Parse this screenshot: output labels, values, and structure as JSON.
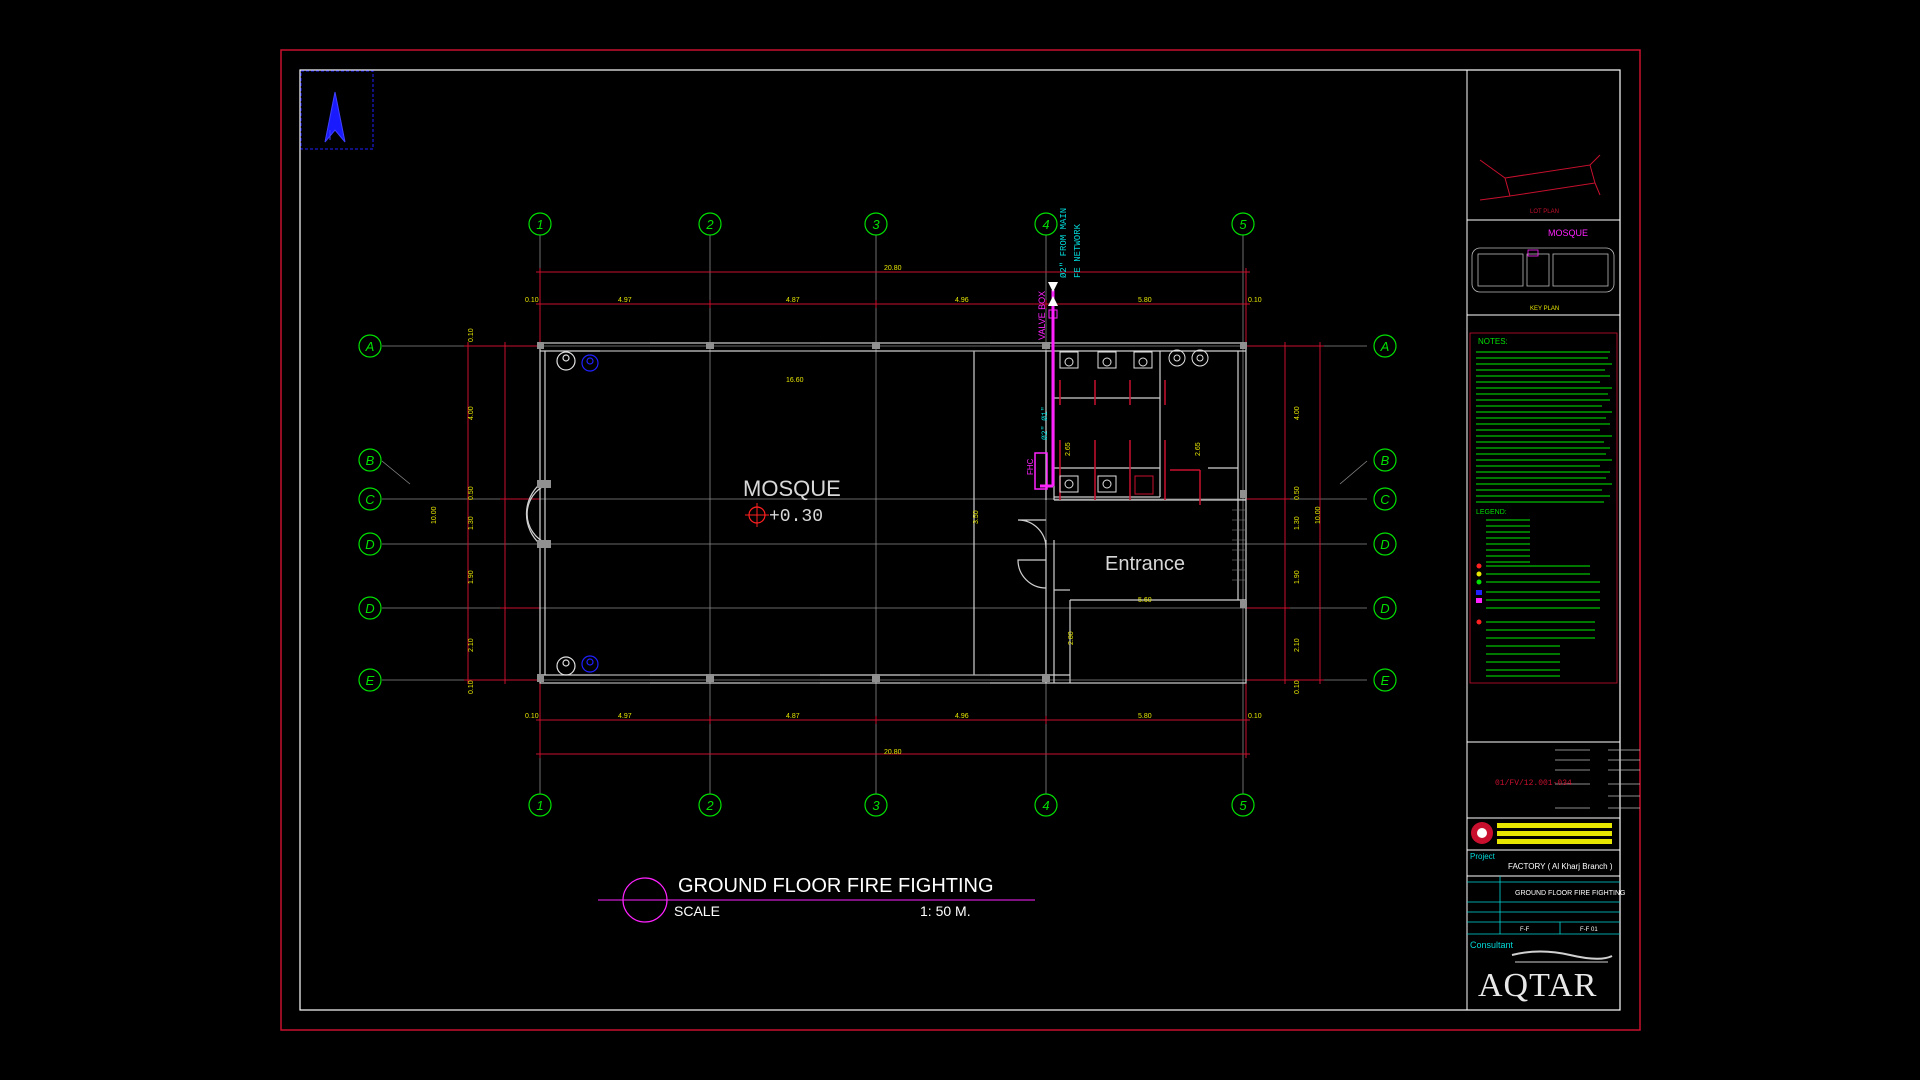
{
  "drawing": {
    "title": "GROUND FLOOR FIRE FIGHTING",
    "scale_label": "SCALE",
    "scale_value": "1: 50 M.",
    "rooms": {
      "mosque": "MOSQUE",
      "entrance": "Entrance"
    },
    "level": "+0.30",
    "pipe_labels": {
      "valve_box": "VALVE BOX",
      "from_main": "Ø2\"  FROM MAIN",
      "fe_network": "FE NETWORK",
      "pipe_size": "Ø2\"  Ø1\"",
      "fhc": "FHC"
    }
  },
  "grid": {
    "columns": [
      "1",
      "2",
      "3",
      "4",
      "5"
    ],
    "rows_left": [
      "A",
      "B",
      "C",
      "D",
      "D",
      "E"
    ],
    "rows_right": [
      "A",
      "B",
      "C",
      "D",
      "D",
      "E"
    ]
  },
  "dimensions": {
    "top_total": "20.80",
    "bottom_total": "20.80",
    "top_spans": [
      "0.10",
      "4.97",
      "4.87",
      "4.96",
      "5.80",
      "0.10"
    ],
    "bottom_spans": [
      "0.10",
      "4.97",
      "4.87",
      "4.96",
      "5.80",
      "0.10"
    ],
    "left_spans": [
      "0.10",
      "4.00",
      "0.50",
      "1.30",
      "1.90",
      "2.10",
      "0.10"
    ],
    "left_total": "10.00",
    "right_spans": [
      "4.00",
      "0.50",
      "1.30",
      "1.90",
      "2.10",
      "0.10"
    ],
    "right_total": "10.00",
    "inner": {
      "mosque_width": "16.60",
      "entrance_width": "5.60",
      "height_350": "3.50",
      "wc_265a": "2.65",
      "wc_265b": "2.65",
      "door_280": "2.80"
    }
  },
  "title_block": {
    "lot_plan_label": "LOT PLAN",
    "key_plan_label": "KEY PLAN",
    "key_plan_marker": "MOSQUE",
    "notes_heading": "NOTES:",
    "legend_heading": "LEGEND:",
    "drawing_no": "01/FV/12.001-034",
    "project_label": "Project",
    "project_name": "FACTORY ( Al Kharj Branch )",
    "sheet_title": "GROUND FLOOR FIRE FIGHTING",
    "sheet_code_a": "F-F",
    "sheet_code_b": "F-F 01",
    "consultant_label": "Consultant",
    "consultant_name": "AQTAR"
  },
  "colors": {
    "frame_red": "#c8102e",
    "white": "#ffffff",
    "grid_green": "#00e000",
    "dim_yellow": "#e6e600",
    "pipe_magenta": "#ff22ff",
    "cyan": "#00d8d8",
    "blue": "#2020ff"
  }
}
